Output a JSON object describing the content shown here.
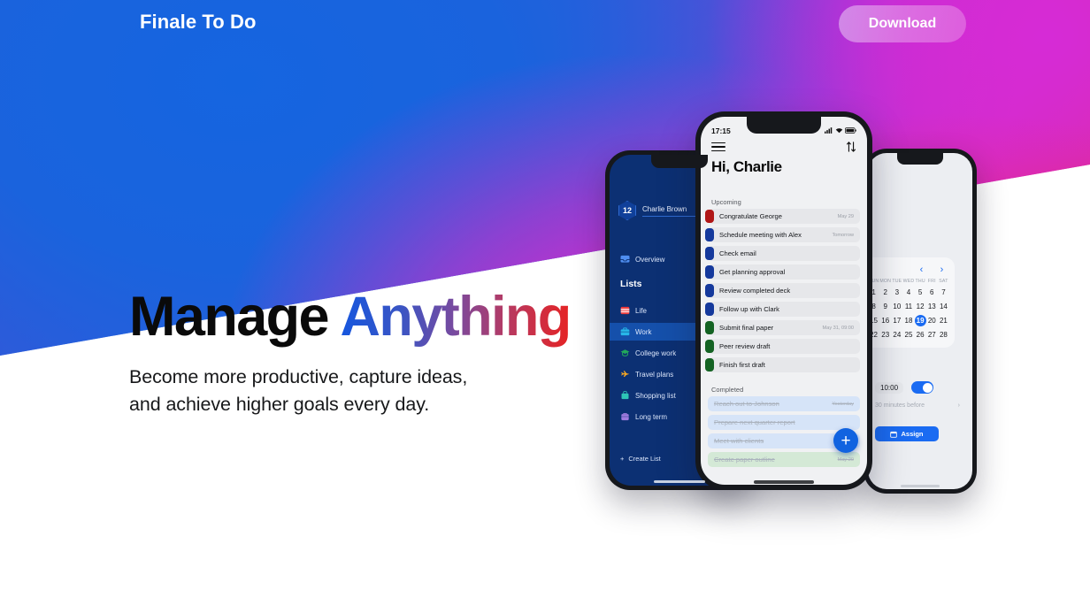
{
  "topbar": {
    "brand": "Finale To Do",
    "download_label": "Download"
  },
  "hero": {
    "headline_plain": "Manage ",
    "headline_accent": "Anything",
    "subcopy_line1": "Become more productive, capture ideas,",
    "subcopy_line2": "and achieve higher goals every day."
  },
  "colors": {
    "brand_blue": "#1a66e4",
    "accent_magenta": "#d42bb8",
    "accent_red": "#e8293f",
    "app_navy": "#0c3073",
    "app_blue": "#1a6bf2"
  },
  "phone_left": {
    "badge_count": "12",
    "user_name": "Charlie Brown",
    "overview_label": "Overview",
    "lists_header": "Lists",
    "lists": [
      {
        "label": "Life",
        "icon": "calendar-icon",
        "active": false
      },
      {
        "label": "Work",
        "icon": "briefcase-icon",
        "active": true
      },
      {
        "label": "College work",
        "icon": "graduation-cap-icon",
        "active": false
      },
      {
        "label": "Travel plans",
        "icon": "airplane-icon",
        "active": false
      },
      {
        "label": "Shopping list",
        "icon": "shopping-bag-icon",
        "active": false
      },
      {
        "label": "Long term",
        "icon": "briefcase-purple-icon",
        "active": false
      }
    ],
    "create_list_label": "Create List"
  },
  "phone_center": {
    "status_time": "17:15",
    "greeting": "Hi, Charlie",
    "menu_icon": "hamburger-menu-icon",
    "sort_icon": "sort-arrows-icon",
    "upcoming_label": "Upcoming",
    "completed_label": "Completed",
    "upcoming_tasks": [
      {
        "name": "Congratulate George",
        "date": "May 29",
        "color": "#b01616"
      },
      {
        "name": "Schedule meeting with Alex",
        "date": "Tomorrow",
        "color": "#15399c"
      },
      {
        "name": "Check email",
        "date": "",
        "color": "#15399c"
      },
      {
        "name": "Get planning approval",
        "date": "",
        "color": "#15399c"
      },
      {
        "name": "Review completed deck",
        "date": "",
        "color": "#15399c"
      },
      {
        "name": "Follow up with Clark",
        "date": "",
        "color": "#15399c"
      },
      {
        "name": "Submit final paper",
        "date": "May 31, 09:00",
        "color": "#146323"
      },
      {
        "name": "Peer review draft",
        "date": "",
        "color": "#146323"
      },
      {
        "name": "Finish first draft",
        "date": "",
        "color": "#146323"
      }
    ],
    "completed_tasks": [
      {
        "name": "Reach out to Johnson",
        "date": "Yesterday",
        "tint": "blue"
      },
      {
        "name": "Prepare next quarter report",
        "date": "",
        "tint": "blue"
      },
      {
        "name": "Meet with clients",
        "date": "",
        "tint": "blue"
      },
      {
        "name": "Create paper outline",
        "date": "May 20",
        "tint": "green"
      }
    ],
    "add_task_label": "+"
  },
  "phone_right": {
    "prev_label": "‹",
    "next_label": "›",
    "dow": [
      "SUN",
      "MON",
      "TUE",
      "WED",
      "THU",
      "FRI",
      "SAT"
    ],
    "dates": [
      "1",
      "2",
      "3",
      "4",
      "5",
      "6",
      "7",
      "8",
      "9",
      "10",
      "11",
      "12",
      "13",
      "14",
      "15",
      "16",
      "17",
      "18",
      "19",
      "20",
      "21",
      "22",
      "23",
      "24",
      "25",
      "26",
      "27",
      "28"
    ],
    "selected_date": "19",
    "time_value": "10:00",
    "reminder_label": "30 minutes before",
    "reminder_chevron": "›",
    "assign_label": "Assign",
    "assign_icon": "calendar-assign-icon"
  }
}
